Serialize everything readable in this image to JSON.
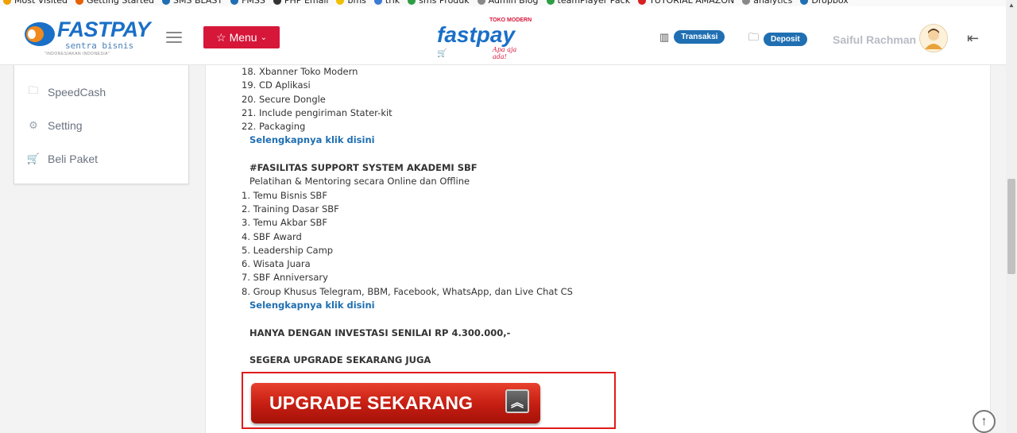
{
  "bookmarks": [
    {
      "label": "Most Visited",
      "color": "#f0a000"
    },
    {
      "label": "Getting Started",
      "color": "#e66000"
    },
    {
      "label": "SMS BLAST",
      "color": "#1f6fb2"
    },
    {
      "label": "FMSS",
      "color": "#1f6fb2"
    },
    {
      "label": "PHP Email",
      "color": "#333333"
    },
    {
      "label": "bms",
      "color": "#f0c000"
    },
    {
      "label": "trik",
      "color": "#3a7bd5"
    },
    {
      "label": "sms Produk",
      "color": "#2e9e44"
    },
    {
      "label": "Admin Blog",
      "color": "#888888"
    },
    {
      "label": "teamPlayer Pack",
      "color": "#2e9e44"
    },
    {
      "label": "TUTORIAL AMAZON",
      "color": "#d62020"
    },
    {
      "label": "analytics",
      "color": "#888888"
    },
    {
      "label": "Dropbox",
      "color": "#1f6fb2"
    }
  ],
  "header": {
    "logo_word": "FASTPAY",
    "logo_sub": "sentra bisnis",
    "logo_tag": "\"INDONESIAKAN INDONESIA\"",
    "menu_label": "Menu",
    "center_logo": {
      "top": "TOKO MODERN",
      "word": "fastpay",
      "slogan": "Apa aja ada!"
    },
    "transaksi_label": "Transaksi",
    "deposit_label": "Deposit",
    "user_name": "Saiful Rachman"
  },
  "sidebar": {
    "items": [
      {
        "label": "SpeedCash",
        "icon": "folder-icon"
      },
      {
        "label": "Setting",
        "icon": "gear-icon"
      },
      {
        "label": "Beli Paket",
        "icon": "cart-icon"
      }
    ]
  },
  "content": {
    "list_a": [
      "18. Xbanner Toko Modern",
      "19. CD Aplikasi",
      "20. Secure Dongle",
      "21. Include pengiriman Stater-kit",
      "22. Packaging"
    ],
    "link_1": "Selengkapnya klik disini",
    "section_head": "#FASILITAS SUPPORT SYSTEM AKADEMI SBF",
    "section_intro": "Pelatihan & Mentoring secara Online dan Offline",
    "list_b": [
      "1. Temu Bisnis SBF",
      "2. Training Dasar SBF",
      "3. Temu Akbar SBF",
      "4. SBF Award",
      "5. Leadership Camp",
      "6. Wisata Juara",
      "7. SBF Anniversary",
      "8. Group Khusus Telegram, BBM, Facebook, WhatsApp, dan Live Chat CS"
    ],
    "link_2": "Selengkapnya klik disini",
    "investasi": "HANYA DENGAN INVESTASI SENILAI RP 4.300.000,-",
    "segera": "SEGERA UPGRADE SEKARANG JUGA",
    "upgrade_label": "UPGRADE SEKARANG"
  },
  "colors": {
    "brand_blue": "#1f6fb2",
    "menu_red": "#d6173a",
    "upgrade_red": "#c41d12",
    "highlight_border": "#e01a1a"
  }
}
